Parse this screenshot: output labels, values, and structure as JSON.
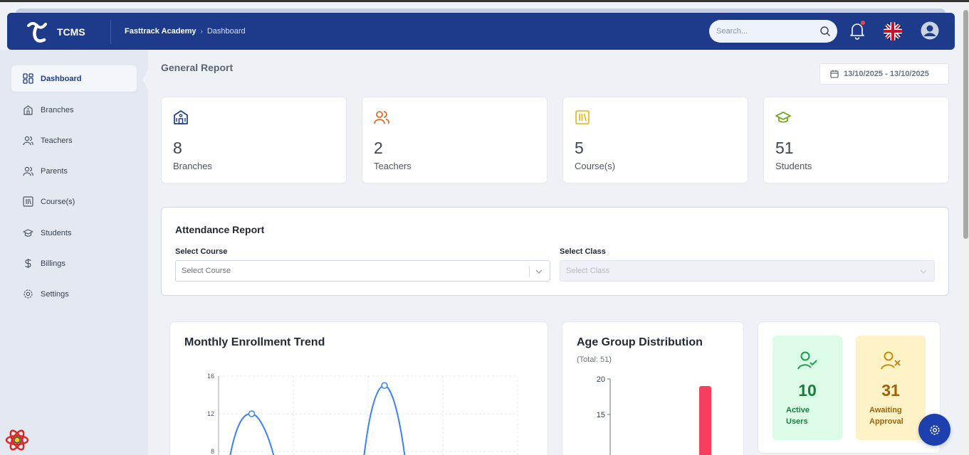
{
  "header": {
    "brand": "TCMS",
    "breadcrumb": {
      "root": "Fasttrack Academy",
      "current": "Dashboard"
    },
    "search_placeholder": "Search...",
    "icons": [
      "logo-icon",
      "search-icon",
      "bell-icon",
      "uk-flag-icon",
      "user-avatar-icon"
    ]
  },
  "sidebar": {
    "items": [
      {
        "label": "Dashboard",
        "icon": "grid-icon",
        "active": true
      },
      {
        "label": "Branches",
        "icon": "building-icon"
      },
      {
        "label": "Teachers",
        "icon": "users-icon"
      },
      {
        "label": "Parents",
        "icon": "users-icon"
      },
      {
        "label": "Course(s)",
        "icon": "books-icon"
      },
      {
        "label": "Students",
        "icon": "graduation-cap-icon"
      },
      {
        "label": "Billings",
        "icon": "dollar-icon"
      },
      {
        "label": "Settings",
        "icon": "gear-icon"
      }
    ]
  },
  "page": {
    "title": "General Report",
    "date_range": "13/10/2025 - 13/10/2025"
  },
  "stats": [
    {
      "value": "8",
      "label": "Branches",
      "color": "#1e3a8a"
    },
    {
      "value": "2",
      "label": "Teachers",
      "color": "#ea580c"
    },
    {
      "value": "5",
      "label": "Course(s)",
      "color": "#eab308"
    },
    {
      "value": "51",
      "label": "Students",
      "color": "#65a30d"
    }
  ],
  "attendance": {
    "title": "Attendance Report",
    "course_label": "Select Course",
    "course_placeholder": "Select Course",
    "class_label": "Select Class",
    "class_placeholder": "Select Class"
  },
  "enrollment": {
    "title": "Monthly Enrollment Trend"
  },
  "age": {
    "title": "Age Group Distribution",
    "subtitle": "(Total: 51)"
  },
  "kpis": {
    "active": {
      "value": "10",
      "label_line1": "Active",
      "label_line2": "Users",
      "bg": "#dcfce7",
      "fg": "#15803d"
    },
    "awaiting": {
      "value": "31",
      "label_line1": "Awaiting",
      "label_line2": "Approval",
      "bg": "#fef3c7",
      "fg": "#a16207"
    }
  },
  "chart_data": [
    {
      "type": "line",
      "title": "Monthly Enrollment Trend",
      "ylim": [
        0,
        16
      ],
      "yticks": [
        "16",
        "12",
        "8"
      ],
      "visible_points": [
        12,
        15
      ],
      "color": "#3b82f6"
    },
    {
      "type": "bar",
      "title": "Age Group Distribution",
      "ylim": [
        0,
        20
      ],
      "yticks": [
        "20",
        "15"
      ],
      "values": [
        19
      ],
      "color": "#f43f5e"
    }
  ]
}
